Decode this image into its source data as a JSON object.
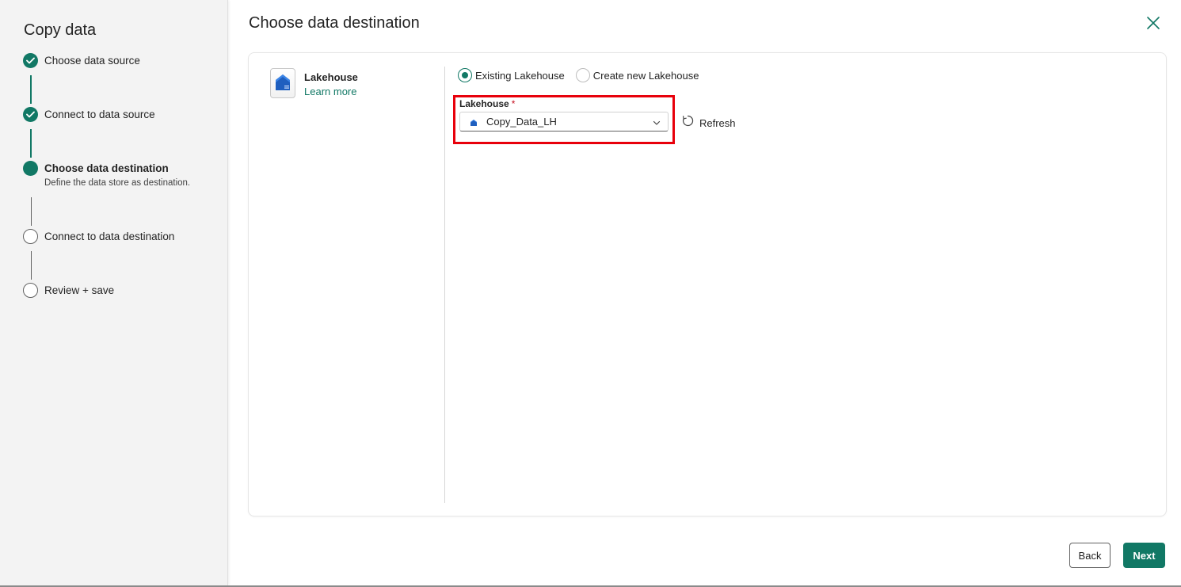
{
  "sidebar": {
    "title": "Copy data",
    "steps": [
      {
        "label": "Choose data source",
        "state": "done"
      },
      {
        "label": "Connect to data source",
        "state": "done"
      },
      {
        "label": "Choose data destination",
        "state": "current",
        "description": "Define the data store as destination."
      },
      {
        "label": "Connect to data destination",
        "state": "todo"
      },
      {
        "label": "Review + save",
        "state": "todo"
      }
    ]
  },
  "header": {
    "title": "Choose data destination",
    "close_icon": "close-icon"
  },
  "destination": {
    "name": "Lakehouse",
    "learn_more": "Learn more",
    "icon": "lakehouse-icon"
  },
  "options": {
    "existing": "Existing Lakehouse",
    "create_new": "Create new Lakehouse",
    "selected": "existing"
  },
  "lakehouse_field": {
    "label": "Lakehouse",
    "required_mark": "*",
    "value": "Copy_Data_LH"
  },
  "refresh_label": "Refresh",
  "footer": {
    "back": "Back",
    "next": "Next"
  },
  "colors": {
    "accent": "#117865",
    "highlight": "#e8000b"
  }
}
